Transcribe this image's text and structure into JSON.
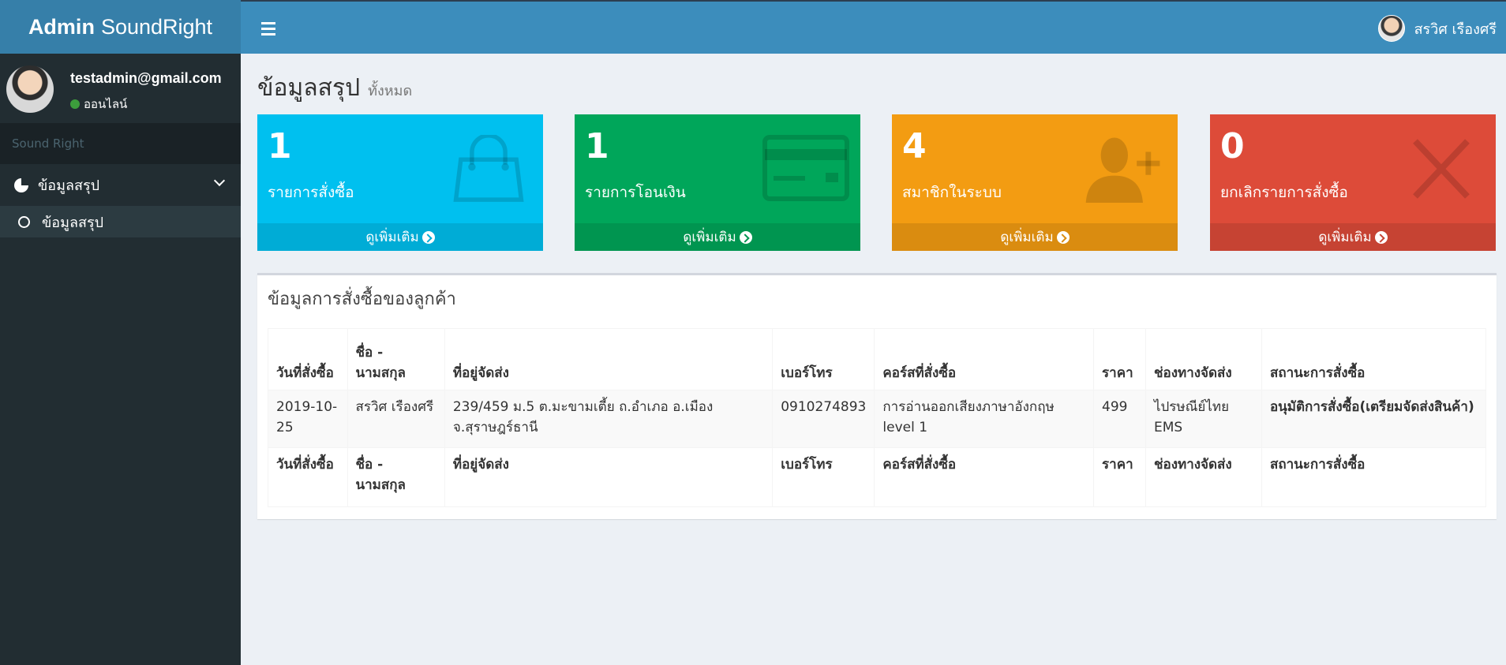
{
  "header": {
    "logo_bold": "Admin",
    "logo_rest": "SoundRight",
    "user_name": "สรวิศ เรืองศรี"
  },
  "sidebar": {
    "email": "testadmin@gmail.com",
    "status": "ออนไลน์",
    "section": "Sound Right",
    "menu_label": "ข้อมูลสรุป",
    "submenu_label": "ข้อมูลสรุป"
  },
  "page": {
    "title": "ข้อมูลสรุป",
    "subtitle": "ทั้งหมด"
  },
  "boxes": [
    {
      "value": "1",
      "label": "รายการสั่งซื้อ",
      "more": "ดูเพิ่มเติม",
      "color": "#00c0ef",
      "icon": "shopping-bag-icon"
    },
    {
      "value": "1",
      "label": "รายการโอนเงิน",
      "more": "ดูเพิ่มเติม",
      "color": "#00a65a",
      "icon": "credit-card-icon"
    },
    {
      "value": "4",
      "label": "สมาชิกในระบบ",
      "more": "ดูเพิ่มเติม",
      "color": "#f39c12",
      "icon": "user-add-icon"
    },
    {
      "value": "0",
      "label": "ยกเลิกรายการสั่งซื้อ",
      "more": "ดูเพิ่มเติม",
      "color": "#dd4b39",
      "icon": "close-icon"
    }
  ],
  "orders": {
    "title": "ข้อมูลการสั่งซื้อของลูกค้า",
    "columns": [
      "วันที่สั่งซื้อ",
      "ชื่อ - นามสกุล",
      "ที่อยู่จัดส่ง",
      "เบอร์โทร",
      "คอร์สที่สั่งซื้อ",
      "ราคา",
      "ช่องทางจัดส่ง",
      "สถานะการสั่งซื้อ"
    ],
    "rows": [
      [
        "2019-10-25",
        "สรวิศ เรืองศรี",
        "239/459 ม.5 ต.มะขามเตี้ย ถ.อำเภอ อ.เมือง จ.สุราษฎร์ธานี",
        "0910274893",
        "การอ่านออกเสียงภาษาอังกฤษ level 1",
        "499",
        "ไปรษณีย์ไทย EMS",
        "อนุมัติการสั่งซื้อ(เตรียมจัดส่งสินค้า)"
      ]
    ]
  }
}
